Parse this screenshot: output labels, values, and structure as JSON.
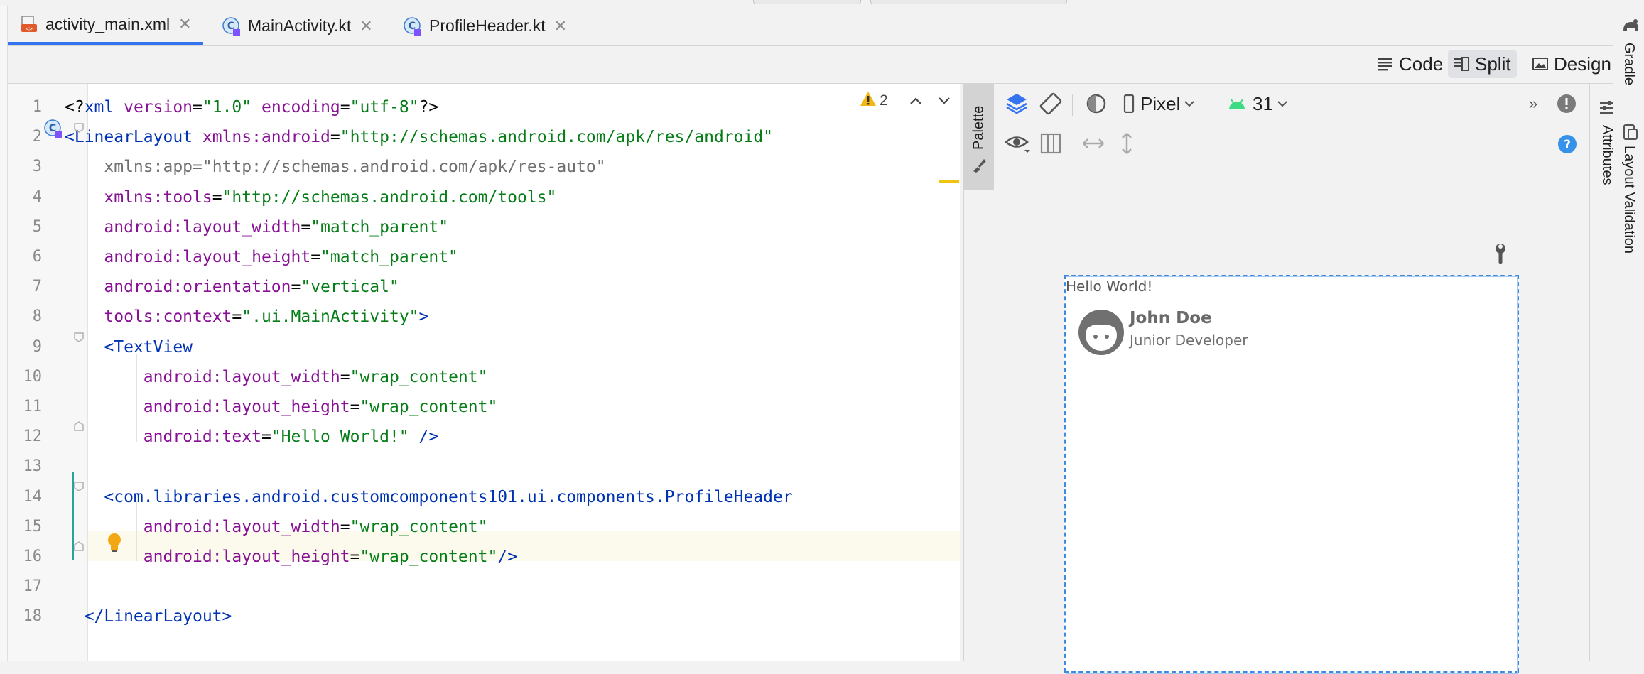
{
  "tabs": [
    {
      "label": "activity_main.xml",
      "icon": "xml-file-icon",
      "active": true
    },
    {
      "label": "MainActivity.kt",
      "icon": "kotlin-file-icon",
      "active": false
    },
    {
      "label": "ProfileHeader.kt",
      "icon": "kotlin-file-icon",
      "active": false
    }
  ],
  "view_modes": {
    "code": "Code",
    "split": "Split",
    "design": "Design",
    "selected": "Split"
  },
  "editor": {
    "warning_count": "2",
    "current_line": 16,
    "lines": [
      {
        "n": "1",
        "parts": [
          [
            "pi",
            "<?"
          ],
          [
            "tag",
            "xml "
          ],
          [
            "attr",
            "version"
          ],
          [
            "pi",
            "="
          ],
          [
            "str",
            "\"1.0\" "
          ],
          [
            "attr",
            "encoding"
          ],
          [
            "pi",
            "="
          ],
          [
            "str",
            "\"utf-8\""
          ],
          [
            "pi",
            "?>"
          ]
        ]
      },
      {
        "n": "2",
        "parts": [
          [
            "tag",
            "<LinearLayout "
          ],
          [
            "attr",
            "xmlns:android"
          ],
          [
            "pi",
            "="
          ],
          [
            "str",
            "\"http://schemas.android.com/apk/res/android\""
          ]
        ]
      },
      {
        "n": "3",
        "parts": [
          [
            "gray",
            "    xmlns:app=\"http://schemas.android.com/apk/res-auto\""
          ]
        ]
      },
      {
        "n": "4",
        "parts": [
          [
            "attr",
            "    xmlns:tools"
          ],
          [
            "pi",
            "="
          ],
          [
            "str",
            "\"http://schemas.android.com/tools\""
          ]
        ]
      },
      {
        "n": "5",
        "parts": [
          [
            "attr",
            "    android:layout_width"
          ],
          [
            "pi",
            "="
          ],
          [
            "str",
            "\"match_parent\""
          ]
        ]
      },
      {
        "n": "6",
        "parts": [
          [
            "attr",
            "    android:layout_height"
          ],
          [
            "pi",
            "="
          ],
          [
            "str",
            "\"match_parent\""
          ]
        ]
      },
      {
        "n": "7",
        "parts": [
          [
            "attr",
            "    android:orientation"
          ],
          [
            "pi",
            "="
          ],
          [
            "str",
            "\"vertical\""
          ]
        ]
      },
      {
        "n": "8",
        "parts": [
          [
            "attr",
            "    tools:context"
          ],
          [
            "pi",
            "="
          ],
          [
            "str",
            "\".ui.MainActivity\""
          ],
          [
            "tag",
            ">"
          ]
        ]
      },
      {
        "n": "9",
        "parts": [
          [
            "tag",
            "    <TextView"
          ]
        ]
      },
      {
        "n": "10",
        "parts": [
          [
            "attr",
            "        android:layout_width"
          ],
          [
            "pi",
            "="
          ],
          [
            "str",
            "\"wrap_content\""
          ]
        ]
      },
      {
        "n": "11",
        "parts": [
          [
            "attr",
            "        android:layout_height"
          ],
          [
            "pi",
            "="
          ],
          [
            "str",
            "\"wrap_content\""
          ]
        ]
      },
      {
        "n": "12",
        "parts": [
          [
            "attr",
            "        android:text"
          ],
          [
            "pi",
            "="
          ],
          [
            "str",
            "\"Hello World!\" "
          ],
          [
            "tag",
            "/>"
          ]
        ]
      },
      {
        "n": "13",
        "parts": []
      },
      {
        "n": "14",
        "parts": [
          [
            "tag",
            "    <com.libraries.android.customcomponents101.ui.components.ProfileHeader"
          ]
        ]
      },
      {
        "n": "15",
        "parts": [
          [
            "attr",
            "        android:layout_width"
          ],
          [
            "pi",
            "="
          ],
          [
            "str",
            "\"wrap_content\""
          ]
        ]
      },
      {
        "n": "16",
        "parts": [
          [
            "attr",
            "        android:layout_height"
          ],
          [
            "pi",
            "="
          ],
          [
            "str",
            "\"wrap_content\""
          ],
          [
            "tag",
            "/>"
          ]
        ]
      },
      {
        "n": "17",
        "parts": []
      },
      {
        "n": "18",
        "parts": [
          [
            "tag",
            "  </LinearLayout>"
          ]
        ]
      }
    ]
  },
  "palette": {
    "label": "Palette"
  },
  "design_toolbar": {
    "device": "Pixel",
    "api_level": "31"
  },
  "preview": {
    "hello_text": "Hello World!",
    "profile_name": "John Doe",
    "profile_role": "Junior Developer"
  },
  "side_panels": {
    "attributes": "Attributes",
    "gradle": "Gradle",
    "layout_validation": "Layout Validation"
  },
  "colors": {
    "accent": "#3574f0",
    "tag": "#0033b3",
    "attr": "#871094",
    "string": "#067d17",
    "selection": "#3d8be0"
  }
}
